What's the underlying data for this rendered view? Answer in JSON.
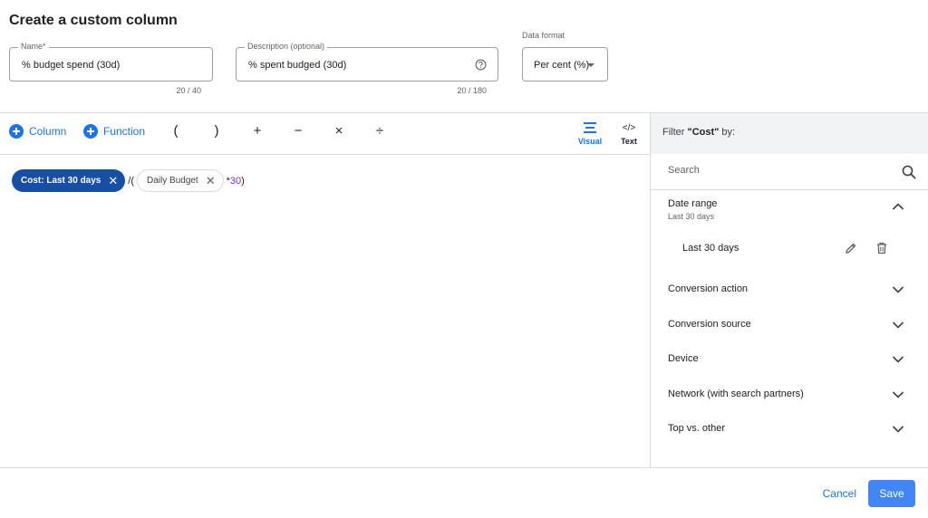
{
  "page": {
    "title": "Create a custom column"
  },
  "name_field": {
    "label": "Name*",
    "value": "% budget spend (30d)",
    "counter": "20 / 40"
  },
  "description_field": {
    "label": "Description (optional)",
    "value": "% spent budged (30d)",
    "counter": "20 / 180",
    "icon": "help-circle-icon"
  },
  "data_format": {
    "label": "Data format",
    "value": "Per cent (%)"
  },
  "toolbar": {
    "column_label": "Column",
    "function_label": "Function",
    "operators": [
      "(",
      ")",
      "+",
      "−",
      "×",
      "÷"
    ],
    "visual_label": "Visual",
    "text_label": "Text",
    "text_icon_glyph": "</>"
  },
  "formula": {
    "chip1": "Cost: Last 30 days",
    "op1": "/(",
    "chip2": "Daily Budget",
    "op2": "*",
    "num": "30",
    "op3": ")"
  },
  "filter_panel": {
    "header_prefix": "Filter ",
    "header_bold": "\"Cost\"",
    "header_suffix": " by:",
    "search_placeholder": "Search",
    "date_range": {
      "title": "Date range",
      "subtitle": "Last 30 days",
      "option": "Last 30 days"
    },
    "items": [
      "Conversion action",
      "Conversion source",
      "Device",
      "Network (with search partners)",
      "Top vs. other"
    ]
  },
  "footer": {
    "cancel_label": "Cancel",
    "save_label": "Save"
  },
  "colors": {
    "accent": "#1a73e8",
    "chip_dark": "#174ea6",
    "save_bg": "#4285f4",
    "number": "#8430ce"
  }
}
